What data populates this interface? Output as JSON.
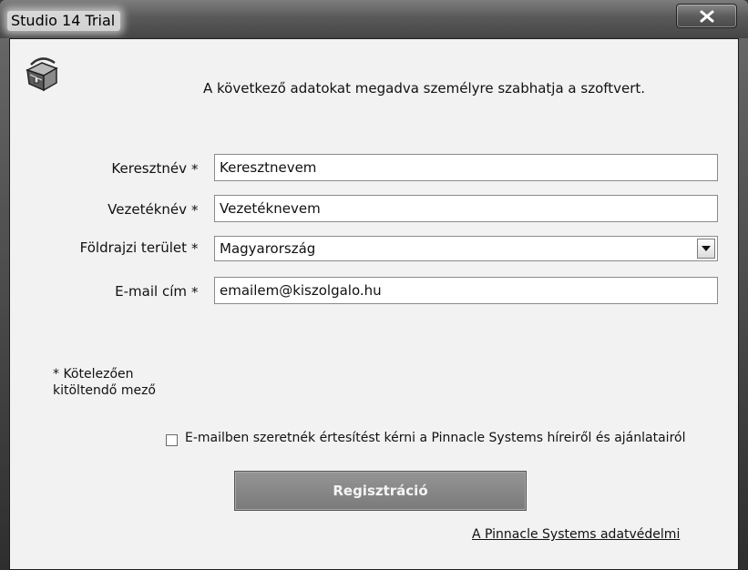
{
  "window": {
    "title": "Studio 14 Trial"
  },
  "header": {
    "intro_text": "A következő adatokat megadva személyre szabhatja a szoftvert.",
    "icon": "treasure-chest-icon"
  },
  "form": {
    "required_marker": "*",
    "first_name": {
      "label": "Keresztnév",
      "value": "Keresztnevem"
    },
    "last_name": {
      "label": "Vezetéknév",
      "value": "Vezetéknevem"
    },
    "region": {
      "label": "Földrajzi terület",
      "value": "Magyarország"
    },
    "email": {
      "label": "E-mail cím",
      "value": "emailem@kiszolgalo.hu"
    }
  },
  "required_note": "* Kötelezően kitöltendő mező",
  "newsletter": {
    "label": "E-mailben szeretnék értesítést kérni a Pinnacle Systems híreiről és ajánlatairól",
    "checked": false
  },
  "register_button": "Regisztráció",
  "privacy_link": "A Pinnacle Systems adatvédelmi",
  "colors": {
    "titlebar": "#5a5a5a",
    "client_background": "#f2f2f2",
    "button": "#878787"
  }
}
